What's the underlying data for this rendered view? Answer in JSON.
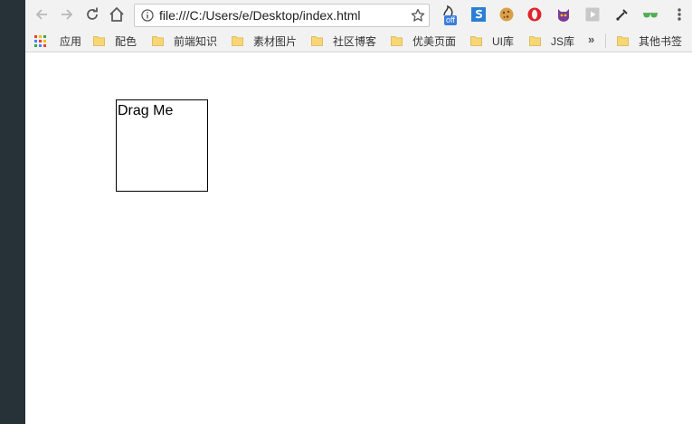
{
  "browser": {
    "url": "file:///C:/Users/e/Desktop/index.html",
    "extension_badge": "off"
  },
  "bookmarks_bar": {
    "apps_label": "应用",
    "items": [
      {
        "label": "配色"
      },
      {
        "label": "前端知识"
      },
      {
        "label": "素材图片"
      },
      {
        "label": "社区博客"
      },
      {
        "label": "优美页面"
      },
      {
        "label": "UI库"
      },
      {
        "label": "JS库"
      }
    ],
    "overflow_label": "»",
    "other_bookmarks_label": "其他书签"
  },
  "page": {
    "drag_box_text": "Drag Me"
  },
  "colors": {
    "side_strip": "#263238",
    "toolbar_bg": "#f2f2f2",
    "folder_yellow": "#f7d774"
  }
}
